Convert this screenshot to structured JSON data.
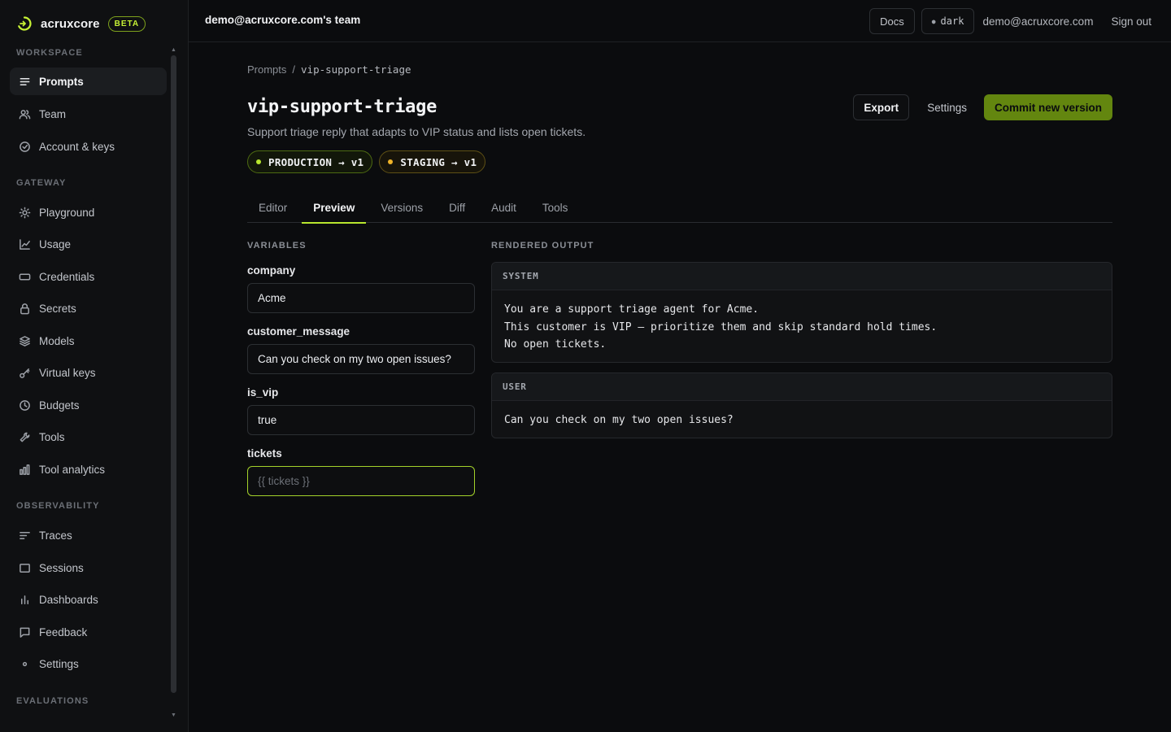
{
  "brand": {
    "name": "acruxcore",
    "badge": "BETA"
  },
  "sidebar": {
    "sections": [
      {
        "label": "WORKSPACE"
      },
      {
        "label": "GATEWAY"
      },
      {
        "label": "OBSERVABILITY"
      },
      {
        "label": "EVALUATIONS"
      }
    ],
    "items": [
      {
        "label": "Prompts",
        "icon": "list-icon"
      },
      {
        "label": "Team",
        "icon": "users-icon"
      },
      {
        "label": "Account & keys",
        "icon": "check-circle-icon"
      },
      {
        "label": "Playground",
        "icon": "sun-icon"
      },
      {
        "label": "Usage",
        "icon": "line-chart-icon"
      },
      {
        "label": "Credentials",
        "icon": "card-icon"
      },
      {
        "label": "Secrets",
        "icon": "lock-icon"
      },
      {
        "label": "Models",
        "icon": "layers-icon"
      },
      {
        "label": "Virtual keys",
        "icon": "key-icon"
      },
      {
        "label": "Budgets",
        "icon": "clock-icon"
      },
      {
        "label": "Tools",
        "icon": "wrench-icon"
      },
      {
        "label": "Tool analytics",
        "icon": "bar-chart-icon"
      },
      {
        "label": "Traces",
        "icon": "traces-icon"
      },
      {
        "label": "Sessions",
        "icon": "window-icon"
      },
      {
        "label": "Dashboards",
        "icon": "dashboard-icon"
      },
      {
        "label": "Feedback",
        "icon": "message-icon"
      },
      {
        "label": "Settings",
        "icon": "settings-dot-icon"
      }
    ]
  },
  "topbar": {
    "team": "demo@acruxcore.com's team",
    "docs": "Docs",
    "theme": "dark",
    "email": "demo@acruxcore.com",
    "signout": "Sign out"
  },
  "breadcrumb": {
    "root": "Prompts",
    "separator": "/",
    "current": "vip-support-triage"
  },
  "page": {
    "title": "vip-support-triage",
    "description": "Support triage reply that adapts to VIP status and lists open tickets.",
    "export": "Export",
    "settings": "Settings",
    "commit": "Commit new version"
  },
  "envs": [
    {
      "label": "PRODUCTION → v1",
      "color": "#b8e62e"
    },
    {
      "label": "STAGING → v1",
      "color": "#f0b429"
    }
  ],
  "tabs": [
    "Editor",
    "Preview",
    "Versions",
    "Diff",
    "Audit",
    "Tools"
  ],
  "active_tab": "Preview",
  "variables": {
    "heading": "VARIABLES",
    "fields": [
      {
        "name": "company",
        "value": "Acme",
        "placeholder": ""
      },
      {
        "name": "customer_message",
        "value": "Can you check on my two open issues?",
        "placeholder": ""
      },
      {
        "name": "is_vip",
        "value": "true",
        "placeholder": ""
      },
      {
        "name": "tickets",
        "value": "",
        "placeholder": "{{ tickets }}"
      }
    ]
  },
  "output": {
    "heading": "RENDERED OUTPUT",
    "system": {
      "role": "SYSTEM",
      "text": "You are a support triage agent for Acme.\nThis customer is VIP — prioritize them and skip standard hold times.\nNo open tickets."
    },
    "user": {
      "role": "USER",
      "text": "Can you check on my two open issues?"
    }
  },
  "colors": {
    "accent": "#b8e62e",
    "commit_bg": "#63860f",
    "staging": "#f0b429"
  }
}
